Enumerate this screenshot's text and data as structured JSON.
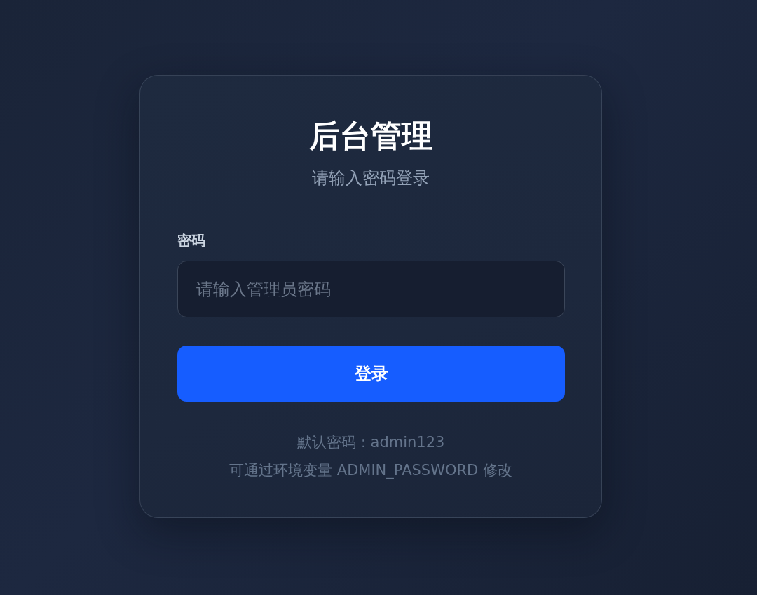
{
  "title": "后台管理",
  "subtitle": "请输入密码登录",
  "password_field": {
    "label": "密码",
    "placeholder": "请输入管理员密码"
  },
  "login_button": {
    "label": "登录"
  },
  "hints": [
    "默认密码：admin123",
    "可通过环境变量 ADMIN_PASSWORD 修改"
  ]
}
